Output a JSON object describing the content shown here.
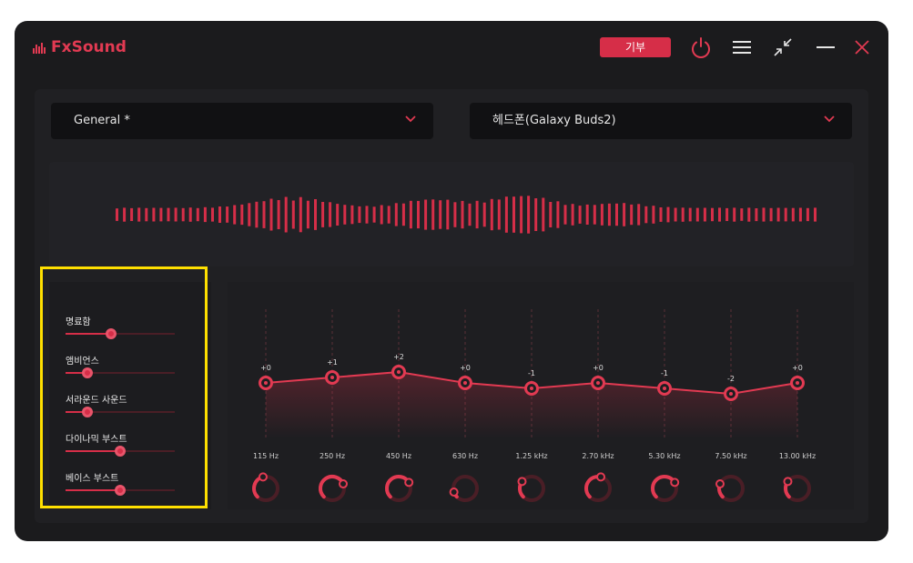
{
  "app": {
    "name": "FxSound"
  },
  "titlebar": {
    "donate_label": "기부",
    "icons": [
      "power-icon",
      "menu-icon",
      "minimize-view-icon",
      "minimize-icon",
      "close-icon"
    ]
  },
  "preset": {
    "value": "General *"
  },
  "output_device": {
    "value": "헤드폰(Galaxy Buds2)"
  },
  "colors": {
    "accent": "#d62e48",
    "background": "#1b1b1d",
    "highlight": "#ffe000"
  },
  "effects": [
    {
      "label": "명료함",
      "level": 0.42
    },
    {
      "label": "앰비언스",
      "level": 0.2
    },
    {
      "label": "서라운드 사운드",
      "level": 0.2
    },
    {
      "label": "다이나믹 부스트",
      "level": 0.5
    },
    {
      "label": "베이스 부스트",
      "level": 0.5
    }
  ],
  "equalizer": {
    "bands": [
      {
        "freq": "115 Hz",
        "gain_label": "+0",
        "gain": 0
      },
      {
        "freq": "250 Hz",
        "gain_label": "+1",
        "gain": 1
      },
      {
        "freq": "450 Hz",
        "gain_label": "+2",
        "gain": 2
      },
      {
        "freq": "630 Hz",
        "gain_label": "+0",
        "gain": 0
      },
      {
        "freq": "1.25 kHz",
        "gain_label": "-1",
        "gain": -1
      },
      {
        "freq": "2.70 kHz",
        "gain_label": "+0",
        "gain": 0
      },
      {
        "freq": "5.30 kHz",
        "gain_label": "-1",
        "gain": -1
      },
      {
        "freq": "7.50 kHz",
        "gain_label": "-2",
        "gain": -2
      },
      {
        "freq": "13.00 kHz",
        "gain_label": "+0",
        "gain": 0
      }
    ],
    "knob_levels": [
      0.45,
      0.75,
      0.72,
      0.1,
      0.3,
      0.55,
      0.72,
      0.25,
      0.3
    ]
  }
}
